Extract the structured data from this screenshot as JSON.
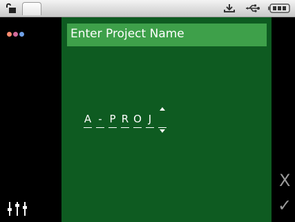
{
  "status_bar": {
    "lock_icon": "unlock-icon",
    "download_icon": "download-icon",
    "usb_icon": "usb-icon",
    "battery_icon": "battery-icon"
  },
  "left_rail": {
    "menu_icon": "menu-dots-icon",
    "menu_dot_colors": [
      "#ff8c70",
      "#d36a99",
      "#6fa0e6"
    ],
    "settings_icon": "sliders-icon"
  },
  "panel": {
    "title": "Enter Project Name",
    "entry": {
      "characters": [
        "A",
        "-",
        "P",
        "R",
        "O",
        "J",
        ""
      ],
      "active_index": 6
    }
  },
  "right_rail": {
    "cancel_label": "X",
    "ok_label": "✓"
  },
  "colors": {
    "panel_bg": "#0e5b21",
    "title_bg": "#3ea04a",
    "text": "#ffffff",
    "rail_icon": "#9a9a9a"
  }
}
